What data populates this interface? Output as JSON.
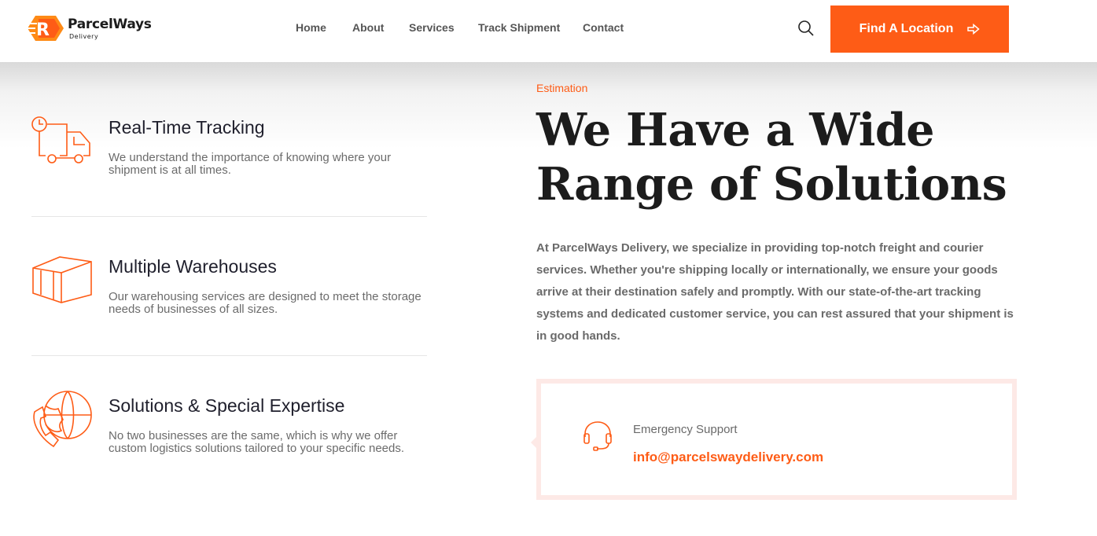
{
  "brand": {
    "name": "ParcelWays",
    "tagline": "Delivery",
    "accent_color": "#fe5c16"
  },
  "nav": {
    "items": [
      {
        "label": "Home"
      },
      {
        "label": "About"
      },
      {
        "label": "Services"
      },
      {
        "label": "Track Shipment"
      },
      {
        "label": "Contact"
      }
    ],
    "search_icon": "search-icon",
    "cta_label": "Find A Location",
    "cta_icon": "arrow-right-icon"
  },
  "features": [
    {
      "icon": "truck-clock-icon",
      "title": "Real-Time Tracking",
      "description": "We understand the importance of knowing where your shipment is at all times."
    },
    {
      "icon": "box-icon",
      "title": "Multiple Warehouses",
      "description": "Our warehousing services are designed to meet the storage needs of businesses of all sizes."
    },
    {
      "icon": "globe-phone-icon",
      "title": "Solutions & Special Expertise",
      "description": "No two businesses are the same, which is why we offer custom logistics solutions tailored to your specific needs."
    }
  ],
  "estimation": {
    "eyebrow": "Estimation",
    "headline": "We Have a Wide Range of Solutions",
    "body": "At ParcelWays Delivery, we specialize in providing top-notch freight and courier services. Whether you're shipping locally or internationally, we ensure your goods arrive at their destination safely and promptly. With our state-of-the-art tracking systems and dedicated customer service, you can rest assured that your shipment is in good hands."
  },
  "support": {
    "icon": "headset-icon",
    "label": "Emergency Support",
    "email": "info@parcelswaydelivery.com"
  }
}
